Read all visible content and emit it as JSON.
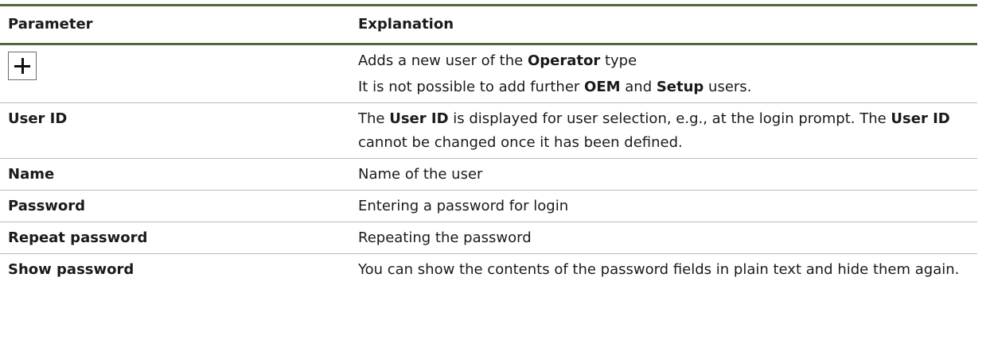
{
  "table": {
    "headers": {
      "parameter": "Parameter",
      "explanation": "Explanation"
    },
    "rows": [
      {
        "icon": "plus-icon",
        "explanation_lines": [
          [
            "Adds a new user of the ",
            "Operator",
            " type"
          ],
          [
            "It is not possible to add further ",
            "OEM",
            " and ",
            "Setup",
            " users."
          ]
        ]
      },
      {
        "parameter": "User ID",
        "explanation": [
          "The ",
          "User ID",
          " is displayed for user selection, e.g., at the login prompt. The ",
          "User ID",
          " cannot be changed once it has been defined."
        ]
      },
      {
        "parameter": "Name",
        "explanation": "Name of the user"
      },
      {
        "parameter": "Password",
        "explanation": "Entering a password for login"
      },
      {
        "parameter": "Repeat password",
        "explanation": "Repeating the password"
      },
      {
        "parameter": "Show password",
        "explanation": "You can show the contents of the password fields in plain text and hide them again."
      }
    ]
  },
  "colors": {
    "header_rule": "#4f6a35",
    "row_divider": "#bcbcbc"
  }
}
